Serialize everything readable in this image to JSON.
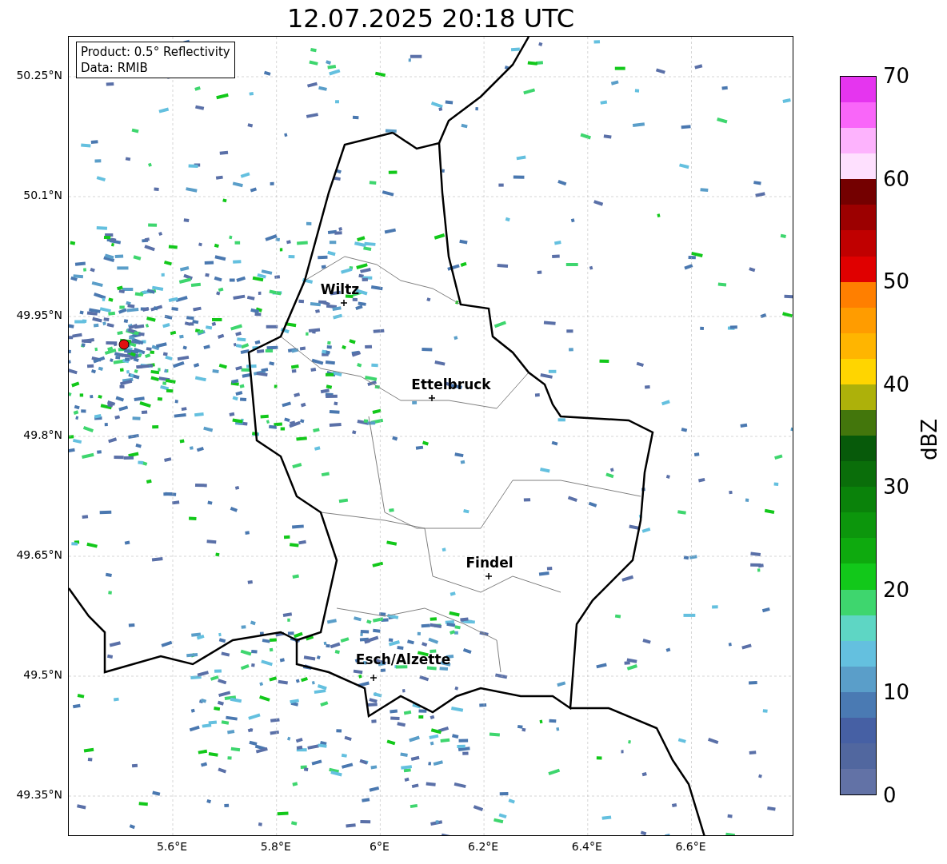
{
  "title": "12.07.2025 20:18 UTC",
  "info_box": {
    "lines": [
      "Product: 0.5° Reflectivity",
      "Data: RMIB"
    ]
  },
  "y_ticks": [
    "50.25°N",
    "50.1°N",
    "49.95°N",
    "49.8°N",
    "49.65°N",
    "49.5°N",
    "49.35°N"
  ],
  "x_ticks": [
    "5.6°E",
    "5.8°E",
    "6°E",
    "6.2°E",
    "6.4°E",
    "6.6°E"
  ],
  "cities": [
    {
      "name": "Wiltz"
    },
    {
      "name": "Ettelbruck"
    },
    {
      "name": "Findel"
    },
    {
      "name": "Esch/Alzette"
    }
  ],
  "colorbar": {
    "label": "dBZ",
    "ticks": [
      "70",
      "60",
      "50",
      "40",
      "30",
      "20",
      "10",
      "0"
    ],
    "bands": [
      {
        "color": "#e535ef"
      },
      {
        "color": "#f966f9"
      },
      {
        "color": "#fdb3fd"
      },
      {
        "color": "#fee0fe"
      },
      {
        "color": "#740000"
      },
      {
        "color": "#9c0000"
      },
      {
        "color": "#c00000"
      },
      {
        "color": "#e00000"
      },
      {
        "color": "#ff7f00"
      },
      {
        "color": "#ff9c00"
      },
      {
        "color": "#ffb500"
      },
      {
        "color": "#ffd500"
      },
      {
        "color": "#adb10a"
      },
      {
        "color": "#43760c"
      },
      {
        "color": "#075a0a"
      },
      {
        "color": "#0a6e0a"
      },
      {
        "color": "#0a820a"
      },
      {
        "color": "#0c960c"
      },
      {
        "color": "#0eaa0e"
      },
      {
        "color": "#12c81a"
      },
      {
        "color": "#3ed66e"
      },
      {
        "color": "#5ed6c4"
      },
      {
        "color": "#64c0df"
      },
      {
        "color": "#5a9ec9"
      },
      {
        "color": "#4a7ab3"
      },
      {
        "color": "#4660a4"
      },
      {
        "color": "#51679f"
      },
      {
        "color": "#6272a6"
      }
    ]
  }
}
